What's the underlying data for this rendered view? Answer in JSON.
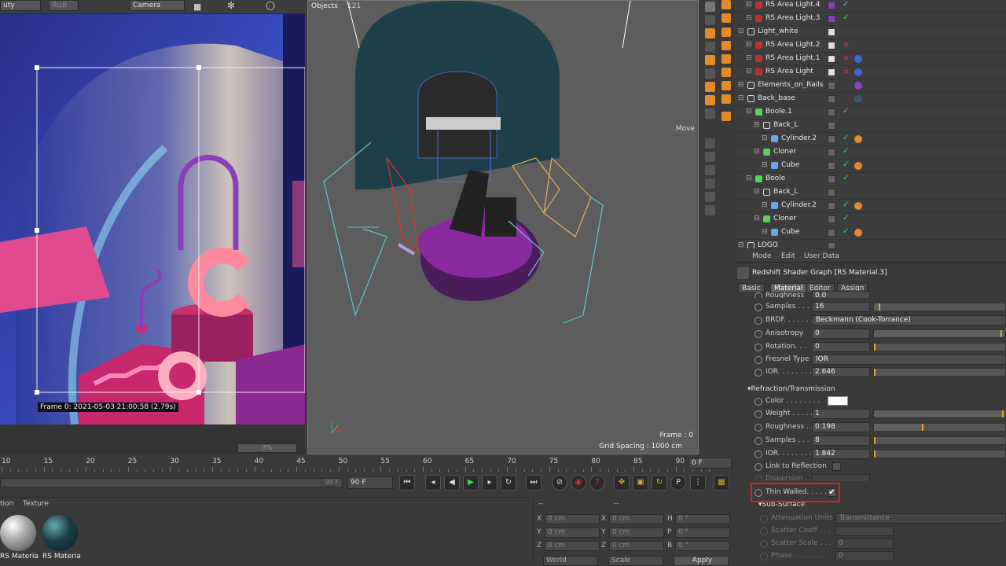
{
  "render_view": {
    "toolbar": {
      "dropdown1": "uty",
      "dropdown2": "RGB",
      "camera": "Camera"
    },
    "frame_info": "Frame  0:  2021-05-03  21:00:58  (2.79s)",
    "progress": "3%"
  },
  "viewport": {
    "menu_label": "Objects",
    "menu_value": "121",
    "move_label": "Move",
    "frame": "Frame : 0",
    "grid_spacing": "Grid Spacing : 1000 cm"
  },
  "object_manager": {
    "rows": [
      {
        "name": "RS Area Light.4",
        "indent": 1
      },
      {
        "name": "RS Area Light.3",
        "indent": 1
      },
      {
        "name": "Light_white",
        "indent": 0
      },
      {
        "name": "RS Area Light.2",
        "indent": 1
      },
      {
        "name": "RS Area Light.1",
        "indent": 1
      },
      {
        "name": "RS Area Light",
        "indent": 1
      },
      {
        "name": "Elements_on_Rails",
        "indent": 0
      },
      {
        "name": "Back_base",
        "indent": 0
      },
      {
        "name": "Boole.1",
        "indent": 1
      },
      {
        "name": "Back_L",
        "indent": 2
      },
      {
        "name": "Cylinder.2",
        "indent": 3
      },
      {
        "name": "Cloner",
        "indent": 2
      },
      {
        "name": "Cube",
        "indent": 3
      },
      {
        "name": "Boole",
        "indent": 1
      },
      {
        "name": "Back_L",
        "indent": 2
      },
      {
        "name": "Cylinder.2",
        "indent": 3
      },
      {
        "name": "Cloner",
        "indent": 2
      },
      {
        "name": "Cube",
        "indent": 3
      },
      {
        "name": "LOGO",
        "indent": 0
      }
    ]
  },
  "attribute_manager": {
    "menu": {
      "mode": "Mode",
      "edit": "Edit",
      "user_data": "User Data"
    },
    "title": "Redshift Shader Graph [RS Material.3]",
    "tabs": [
      "Basic",
      "Material",
      "Editor",
      "Assign"
    ],
    "active_tab": "Material",
    "props_top": [
      {
        "label": "Roughness",
        "value": "0.0"
      },
      {
        "label": "Samples . . .",
        "value": "16",
        "fill": 0.05
      },
      {
        "label": "BRDF. . . . . . .",
        "dropdown": "Beckmann (Cook-Torrance)"
      },
      {
        "label": "Anisotropy",
        "value": "0",
        "fill": 0.99
      },
      {
        "label": "Rotation. . .",
        "value": "0",
        "fill": 0.0
      },
      {
        "label": "Fresnel Type",
        "dropdown": "IOR"
      },
      {
        "label": "IOR. . . . . . . .",
        "value": "2.646",
        "fill": 0.0
      }
    ],
    "section_refraction": "Refraction/Transmission",
    "props_refr": [
      {
        "label": "Color . . . . . . . .",
        "swatch": "#ffffff"
      },
      {
        "label": "Weight . . . . . . .",
        "value": "1",
        "fill": 1.0
      },
      {
        "label": "Roughness . . . . .",
        "value": "0.198",
        "fill": 0.38
      },
      {
        "label": "Samples . . . . . .",
        "value": "8",
        "fill": 0.01
      },
      {
        "label": "IOR. . . . . . . . . .",
        "value": "1.842",
        "fill": 0.0
      },
      {
        "label": "Link to Reflection",
        "checkbox": false
      }
    ],
    "dispersion_label": "Dispersion . . . . .",
    "thin_walled_label": "Thin Walled. . . . .",
    "thin_walled_checked": "✔",
    "section_subsurface": "Sub-Surface",
    "props_sub": [
      {
        "label": "Attenuation Units",
        "dropdown": "Transmittance"
      },
      {
        "label": "Scatter Coeff . . .",
        "value": ""
      },
      {
        "label": "Scatter Scale . . .",
        "value": "0"
      },
      {
        "label": "Phase . . . . . . . .",
        "value": "0"
      }
    ]
  },
  "timeline": {
    "ticks": [
      "10",
      "15",
      "20",
      "25",
      "30",
      "35",
      "40",
      "45",
      "50",
      "55",
      "60",
      "65",
      "70",
      "75",
      "80",
      "85",
      "90"
    ],
    "current_frame": "0 F",
    "end_frame": "90 F",
    "end_frame2": "90 F"
  },
  "material_manager": {
    "menu_partial": "tion",
    "menu_texture": "Texture",
    "materials": [
      "RS Materia",
      "RS Materia"
    ]
  },
  "coordinates": {
    "header": "--",
    "header2": "--",
    "rows": [
      {
        "a": "X",
        "av": "0 cm",
        "b": "X",
        "bv": "0 cm",
        "c": "H",
        "cv": "0 °"
      },
      {
        "a": "Y",
        "av": "0 cm",
        "b": "Y",
        "bv": "0 cm",
        "c": "P",
        "cv": "0 °"
      },
      {
        "a": "Z",
        "av": "0 cm",
        "b": "Z",
        "bv": "0 cm",
        "c": "B",
        "cv": "0 °"
      }
    ],
    "world": "World",
    "scale": "Scale",
    "apply": "Apply"
  },
  "colors": {
    "accent": "#e3a92a",
    "highlight": "#e31b23",
    "purple": "#8a3fb8",
    "teal": "#1c3f4a"
  }
}
